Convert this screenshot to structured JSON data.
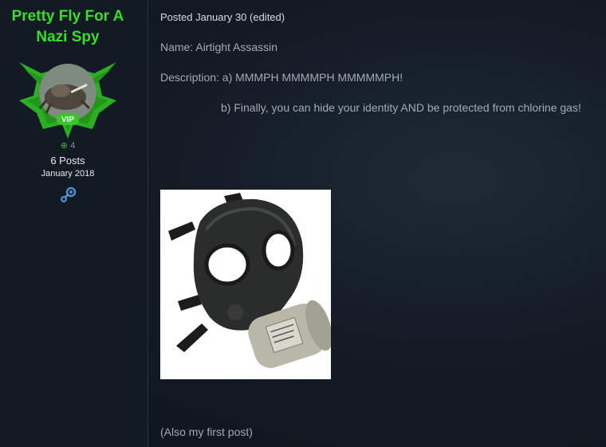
{
  "author": {
    "username": "Pretty Fly For A Nazi Spy",
    "badge": "VIP",
    "reputation": "4",
    "posts": "6 Posts",
    "joined": "January 2018",
    "username_color": "#35e027",
    "badge_color": "#37c72b"
  },
  "post": {
    "meta": "Posted January 30 (edited)",
    "name_line": "Name: Airtight Assassin",
    "description_a": "Description: a) MMMPH MMMMPH MMMMMPH!",
    "description_b": "b) Finally, you can hide your identity AND be protected from chlorine gas!",
    "footer": "(Also my first post)"
  },
  "icons": {
    "reputation": "plus-circle-icon",
    "profile_link": "steam-icon"
  }
}
